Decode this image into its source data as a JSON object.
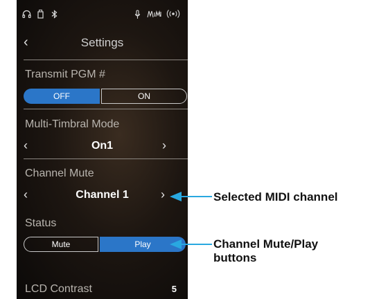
{
  "status_icons": [
    "headphones-icon",
    "usb-icon",
    "bluetooth-icon",
    "microphone-icon",
    "midi-icon",
    "wireless-icon"
  ],
  "header": {
    "title": "Settings"
  },
  "transmit_pgm": {
    "label": "Transmit PGM #",
    "off": "OFF",
    "on": "ON",
    "selected": "OFF"
  },
  "multi_timbral": {
    "label": "Multi-Timbral Mode",
    "value": "On1"
  },
  "channel_mute": {
    "label": "Channel Mute",
    "value": "Channel 1"
  },
  "status": {
    "label": "Status",
    "mute": "Mute",
    "play": "Play",
    "selected": "Play"
  },
  "lcd_contrast": {
    "label": "LCD Contrast",
    "value": "5"
  },
  "callouts": {
    "selected_channel": "Selected MIDI channel",
    "mute_play_line1": "Channel Mute/Play",
    "mute_play_line2": "buttons"
  },
  "colors": {
    "accent": "#2b76c8",
    "callout_arrow": "#29a8e0"
  }
}
